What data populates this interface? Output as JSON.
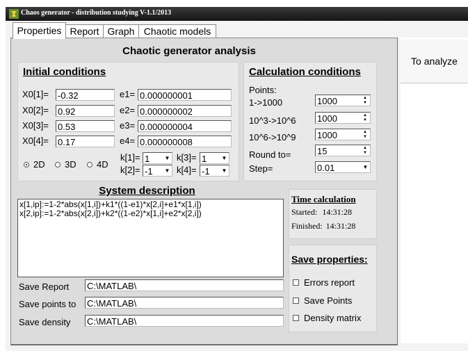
{
  "window": {
    "title": "Chaos generator - distribution studying  V-1.1/2013"
  },
  "tabs": [
    "Properties",
    "Report",
    "Graph",
    "Chaotic models"
  ],
  "header": {
    "title": "Chaotic generator analysis"
  },
  "analyze_button": "To analyze",
  "initial_conditions": {
    "heading": "Initial conditions",
    "x": [
      {
        "label": "X0[1]=",
        "value": "-0.32"
      },
      {
        "label": "X0[2]=",
        "value": "0.92"
      },
      {
        "label": "X0[3]=",
        "value": "0.53"
      },
      {
        "label": "X0[4]=",
        "value": "0.17"
      }
    ],
    "e": [
      {
        "label": "e1=",
        "value": "0.000000001"
      },
      {
        "label": "e2=",
        "value": "0.000000002"
      },
      {
        "label": "e3=",
        "value": "0.000000004"
      },
      {
        "label": "e4=",
        "value": "0.000000008"
      }
    ],
    "dimension": {
      "options": [
        "2D",
        "3D",
        "4D"
      ],
      "selected": "2D"
    },
    "k": [
      {
        "label": "k[1]=",
        "value": "1"
      },
      {
        "label": "k[2]=",
        "value": "-1"
      },
      {
        "label": "k[3]=",
        "value": "1"
      },
      {
        "label": "k[4]=",
        "value": "-1"
      }
    ]
  },
  "calculation_conditions": {
    "heading": "Calculation conditions",
    "points_label": "Points:",
    "rows": [
      {
        "label": "1->1000",
        "value": "1000"
      },
      {
        "label": "10^3->10^6",
        "value": "1000"
      },
      {
        "label": "10^6->10^9",
        "value": "1000"
      },
      {
        "label": "Round to=",
        "value": "15"
      }
    ],
    "step": {
      "label": "Step=",
      "value": "0.01"
    }
  },
  "system_description": {
    "heading": "System description",
    "lines": [
      "x[1,ip]:=1-2*abs(x[1,i])+k1*((1-e1)*x[2,i]+e1*x[1,i])",
      "x[2,ip]:=1-2*abs(x[2,i])+k2*((1-e2)*x[1,i]+e2*x[2,i])"
    ]
  },
  "time_calculation": {
    "heading": "Time calculation",
    "started_label": "Started:",
    "started_value": "14:31:28",
    "finished_label": "Finished:",
    "finished_value": "14:31:28"
  },
  "save_paths": [
    {
      "label": "Save Report",
      "value": "C:\\MATLAB\\"
    },
    {
      "label": "Save points to",
      "value": "C:\\MATLAB\\"
    },
    {
      "label": "Save density",
      "value": "C:\\MATLAB\\"
    }
  ],
  "save_properties": {
    "heading": "Save properties:",
    "options": [
      {
        "label": "Errors report",
        "checked": false
      },
      {
        "label": "Save Points",
        "checked": false
      },
      {
        "label": "Density matrix",
        "checked": false
      }
    ]
  },
  "colors": {
    "titlebar": "#1f1f1f",
    "panel": "#dcdcdc",
    "box": "#e9e9e9"
  }
}
